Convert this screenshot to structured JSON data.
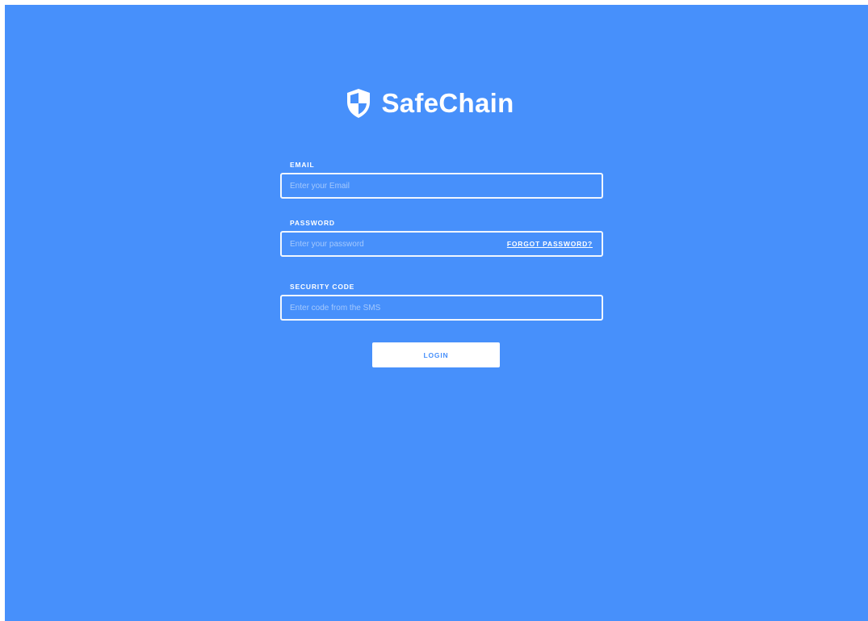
{
  "brand": {
    "name": "SafeChain",
    "icon": "shield-icon"
  },
  "form": {
    "email": {
      "label": "EMAIL",
      "placeholder": "Enter your Email",
      "value": ""
    },
    "password": {
      "label": "PASSWORD",
      "placeholder": "Enter your password",
      "value": "",
      "forgot_link": "FORGOT PASSWORD?"
    },
    "security_code": {
      "label": "SECURITY CODE",
      "placeholder": "Enter code from the SMS",
      "value": ""
    },
    "login_label": "LOGIN"
  },
  "colors": {
    "background": "#4790fb",
    "foreground": "#ffffff",
    "button_text": "#4790fb"
  }
}
